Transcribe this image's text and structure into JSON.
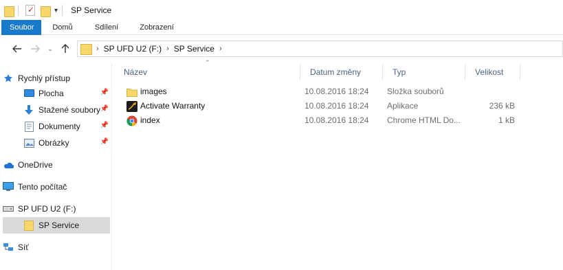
{
  "window": {
    "title": "SP Service"
  },
  "ribbon": {
    "tabs": [
      "Soubor",
      "Domů",
      "Sdílení",
      "Zobrazení"
    ]
  },
  "address": {
    "crumbs": [
      "SP UFD U2 (F:)",
      "SP Service"
    ]
  },
  "sidebar": {
    "items": [
      {
        "label": "Rychlý přístup",
        "icon": "star-icon"
      },
      {
        "label": "Plocha",
        "icon": "desktop-icon",
        "pinned": true
      },
      {
        "label": "Stažené soubory",
        "icon": "download-icon",
        "pinned": true
      },
      {
        "label": "Dokumenty",
        "icon": "document-icon",
        "pinned": true
      },
      {
        "label": "Obrázky",
        "icon": "pictures-icon",
        "pinned": true
      },
      {
        "label": "OneDrive",
        "icon": "cloud-icon"
      },
      {
        "label": "Tento počítač",
        "icon": "computer-icon"
      },
      {
        "label": "SP UFD U2 (F:)",
        "icon": "drive-icon"
      },
      {
        "label": "SP Service",
        "icon": "folder-icon",
        "selected": true
      },
      {
        "label": "Síť",
        "icon": "network-icon"
      }
    ]
  },
  "columns": {
    "name": "Název",
    "date": "Datum změny",
    "type": "Typ",
    "size": "Velikost"
  },
  "files": [
    {
      "name": "images",
      "date": "10.08.2016 18:24",
      "type": "Složka souborů",
      "size": "",
      "icon": "folder-icon"
    },
    {
      "name": "Activate Warranty",
      "date": "10.08.2016 18:24",
      "type": "Aplikace",
      "size": "236 kB",
      "icon": "app-icon"
    },
    {
      "name": "index",
      "date": "10.08.2016 18:24",
      "type": "Chrome HTML Do...",
      "size": "1 kB",
      "icon": "chrome-icon"
    }
  ],
  "colors": {
    "accent": "#1979ca",
    "folder": "#f8d76a",
    "selected": "#d9d9d9"
  }
}
